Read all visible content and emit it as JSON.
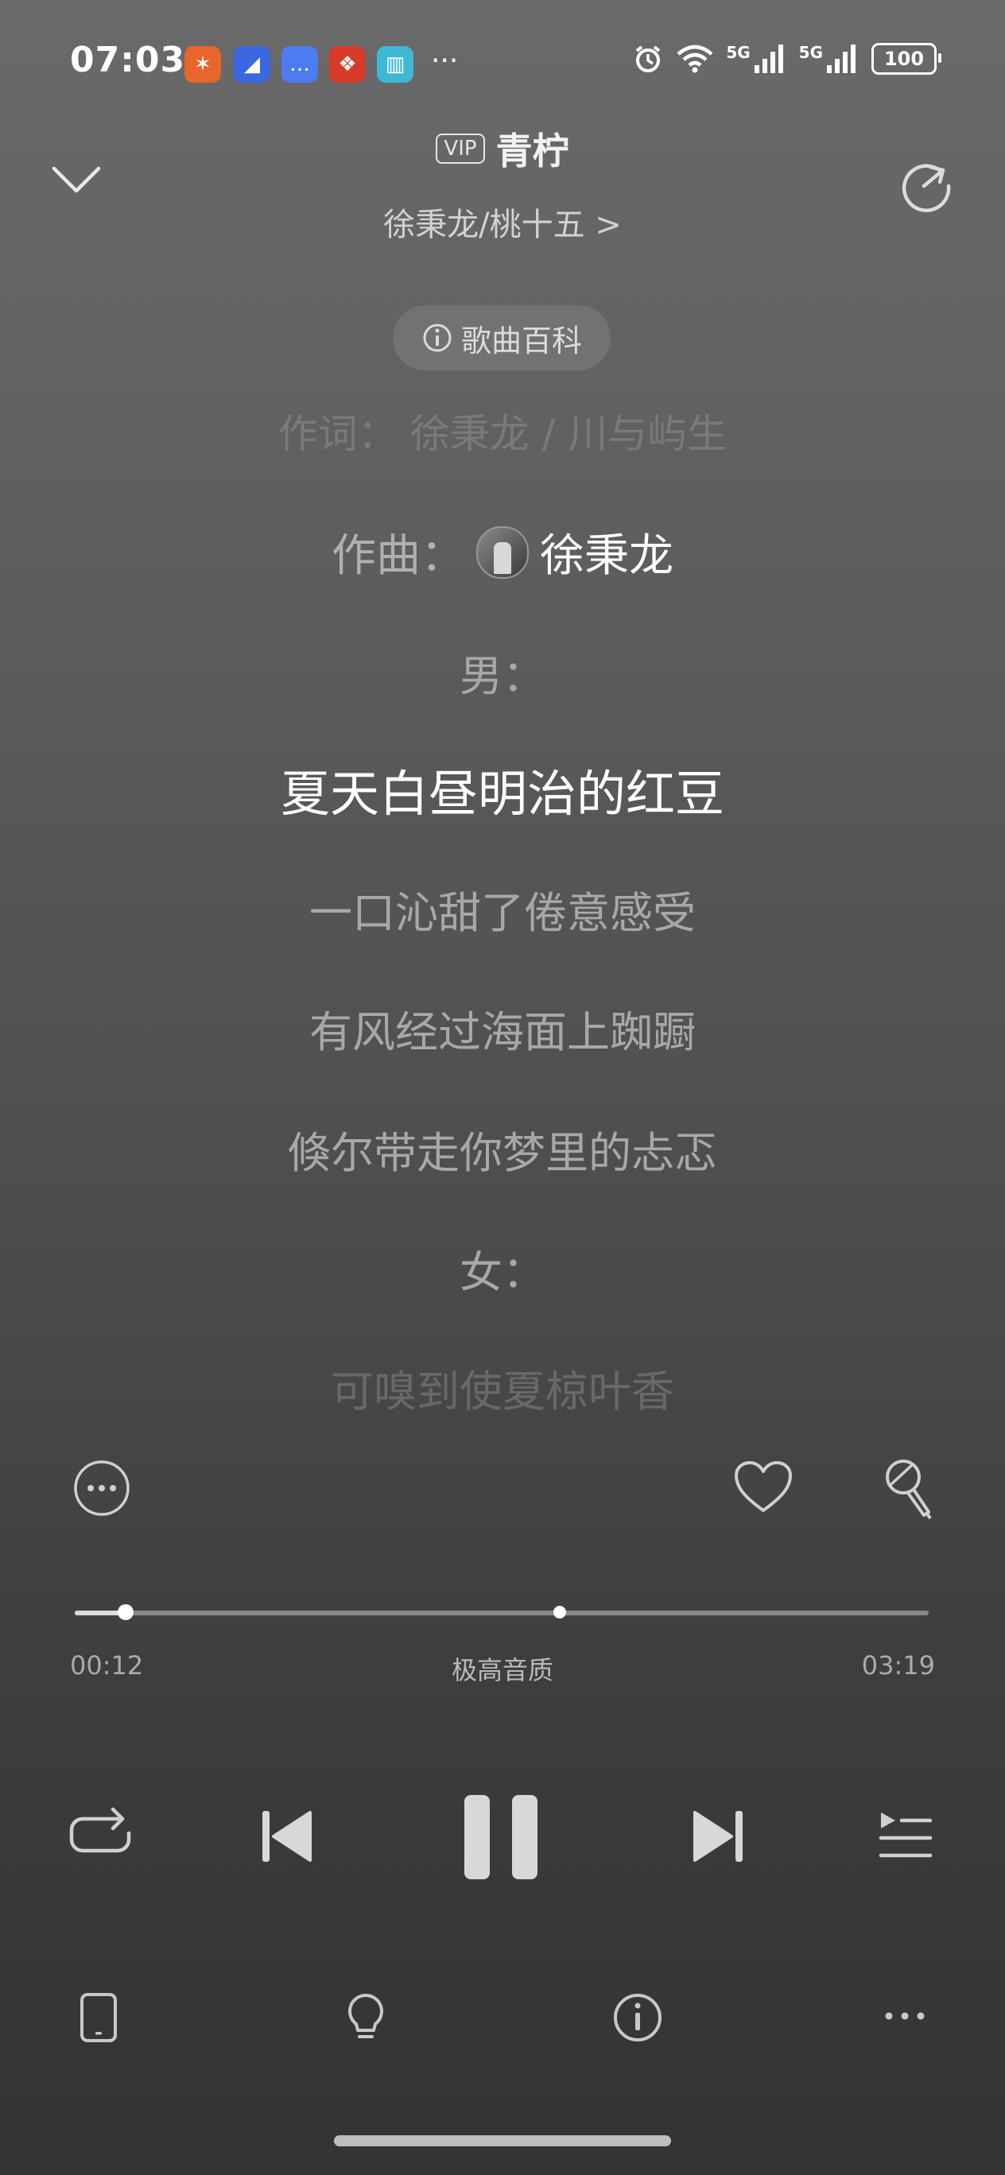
{
  "status_bar": {
    "time": "07:03",
    "more": "···",
    "signal_1": "5G",
    "signal_2": "5G",
    "battery": "100"
  },
  "header": {
    "vip_badge": "VIP",
    "title": "青柠",
    "artist": "徐秉龙/桃十五 >"
  },
  "song_wiki_button": "歌曲百科",
  "lyrics": {
    "lyricist_line": "作词：  徐秉龙 / 川与屿生",
    "composer_label": "作曲：",
    "composer_name": "徐秉龙",
    "lines": [
      "男：",
      "夏天白昼明治的红豆",
      "一口沁甜了倦意感受",
      "有风经过海面上踟蹰",
      "倏尔带走你梦里的忐忑",
      "女：",
      "可嗅到使夏椋叶香"
    ],
    "active_index": 1
  },
  "progress": {
    "current": "00:12",
    "total": "03:19",
    "quality": "极高音质",
    "played_fraction": 0.06,
    "buffered_marker_fraction": 0.57
  },
  "colors": {
    "background_top": "#6a6a6a",
    "background_bottom": "#333333",
    "active_lyric": "#ffffff",
    "inactive_lyric": "#a8a8a8"
  }
}
